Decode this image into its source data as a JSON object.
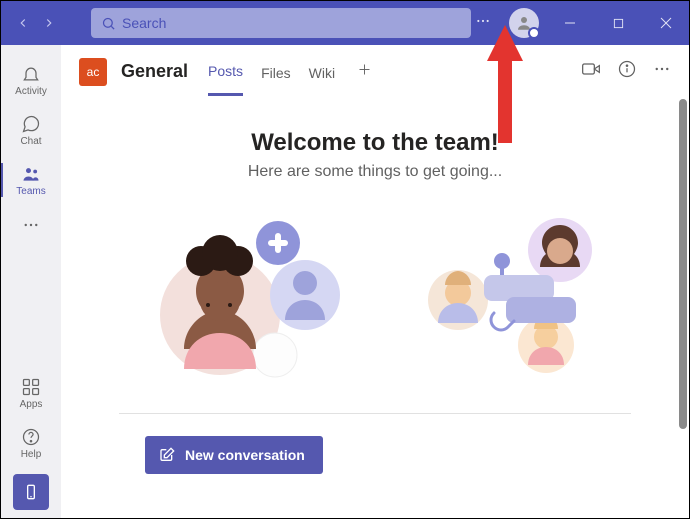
{
  "colors": {
    "accent": "#5558af",
    "titlebar": "#4a51b7",
    "teamTile": "#dc4e1f",
    "arrow": "#e3342f"
  },
  "search": {
    "placeholder": "Search"
  },
  "rail": {
    "items": [
      {
        "label": "Activity"
      },
      {
        "label": "Chat"
      },
      {
        "label": "Teams"
      }
    ],
    "apps": {
      "label": "Apps"
    },
    "help": {
      "label": "Help"
    }
  },
  "channel": {
    "teamInitials": "ac",
    "name": "General",
    "tabs": [
      {
        "label": "Posts"
      },
      {
        "label": "Files"
      },
      {
        "label": "Wiki"
      }
    ]
  },
  "welcome": {
    "title": "Welcome to the team!",
    "subtitle": "Here are some things to get going..."
  },
  "compose": {
    "button": "New conversation"
  }
}
